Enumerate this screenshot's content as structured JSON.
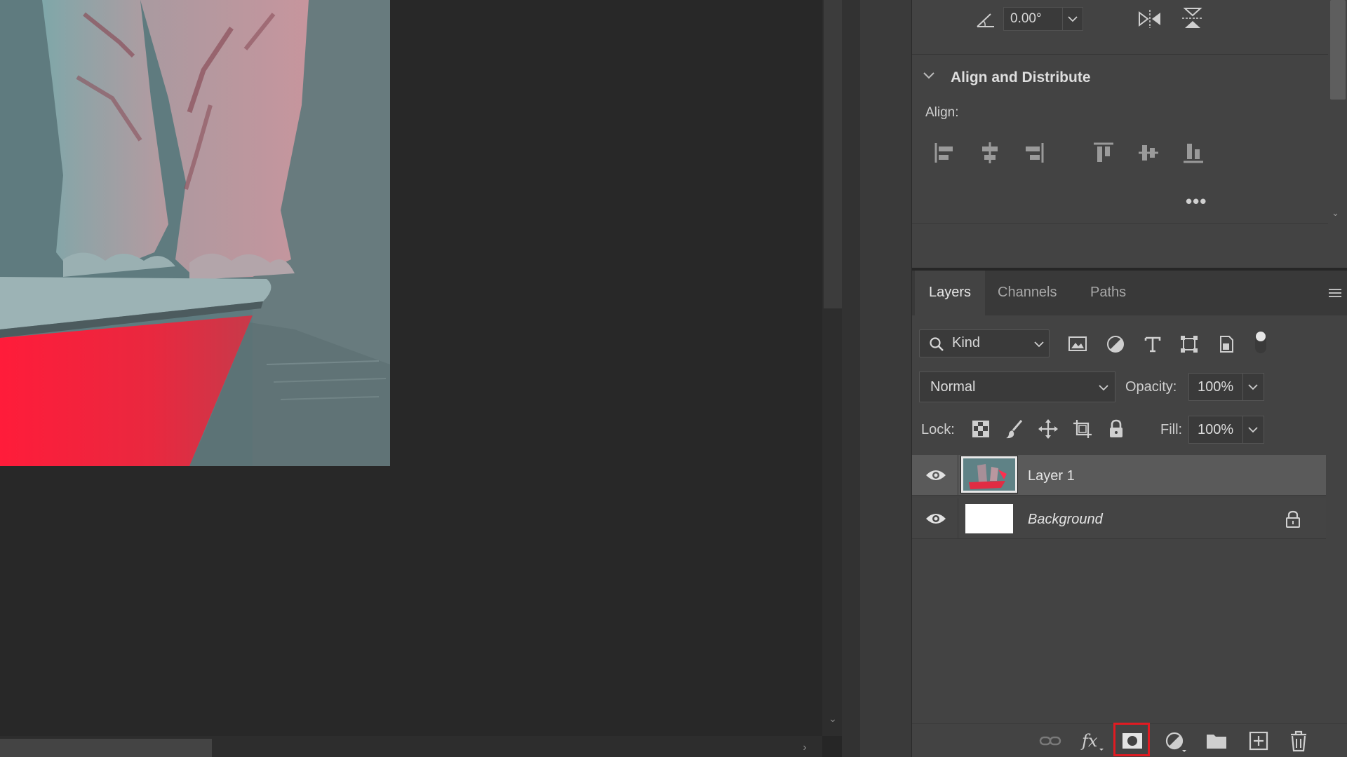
{
  "colors": {
    "canvas_bg": "#282828",
    "panel_bg": "#434343",
    "highlight": "#e11b22",
    "selected_layer": "#5a5a5a"
  },
  "properties": {
    "angle_value": "0.00°",
    "align_section_title": "Align and Distribute",
    "align_label": "Align:",
    "more_label": "•••",
    "align_buttons": [
      "align-left-edges-icon",
      "align-horizontal-centers-icon",
      "align-right-edges-icon",
      "align-top-edges-icon",
      "align-vertical-centers-icon",
      "align-bottom-edges-icon"
    ]
  },
  "layers_panel": {
    "tabs": [
      "Layers",
      "Channels",
      "Paths"
    ],
    "active_tab": "Layers",
    "filter_kind": "Kind",
    "blend_mode": "Normal",
    "opacity_label": "Opacity:",
    "opacity_value": "100%",
    "lock_label": "Lock:",
    "fill_label": "Fill:",
    "fill_value": "100%",
    "layers": [
      {
        "name": "Layer 1",
        "visible": true,
        "selected": true,
        "locked": false
      },
      {
        "name": "Background",
        "visible": true,
        "selected": false,
        "locked": true
      }
    ],
    "footer_icons": [
      "link-layers-icon",
      "fx-layer-style-icon",
      "add-layer-mask-icon",
      "adjustment-layer-icon",
      "new-group-icon",
      "new-layer-icon",
      "delete-layer-icon"
    ],
    "highlighted_footer_button": "add-layer-mask-icon"
  }
}
